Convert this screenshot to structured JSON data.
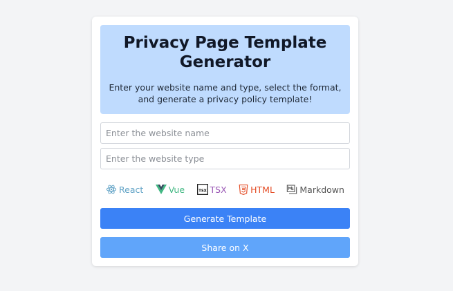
{
  "header": {
    "title": "Privacy Page Template Generator",
    "subtitle": "Enter your website name and type, select the format, and generate a privacy policy template!"
  },
  "inputs": {
    "name_placeholder": "Enter the website name",
    "type_placeholder": "Enter the website type"
  },
  "formats": [
    {
      "label": "React",
      "icon": "react-icon",
      "color": "#61a3c6"
    },
    {
      "label": "Vue",
      "icon": "vue-icon",
      "color": "#42b883"
    },
    {
      "label": "TSX",
      "icon": "tsx-icon",
      "color": "#9b59b6"
    },
    {
      "label": "HTML",
      "icon": "html5-icon",
      "color": "#e44d26"
    },
    {
      "label": "Markdown",
      "icon": "markdown-icon",
      "color": "#555555"
    }
  ],
  "buttons": {
    "generate_label": "Generate Template",
    "share_label": "Share on X"
  }
}
